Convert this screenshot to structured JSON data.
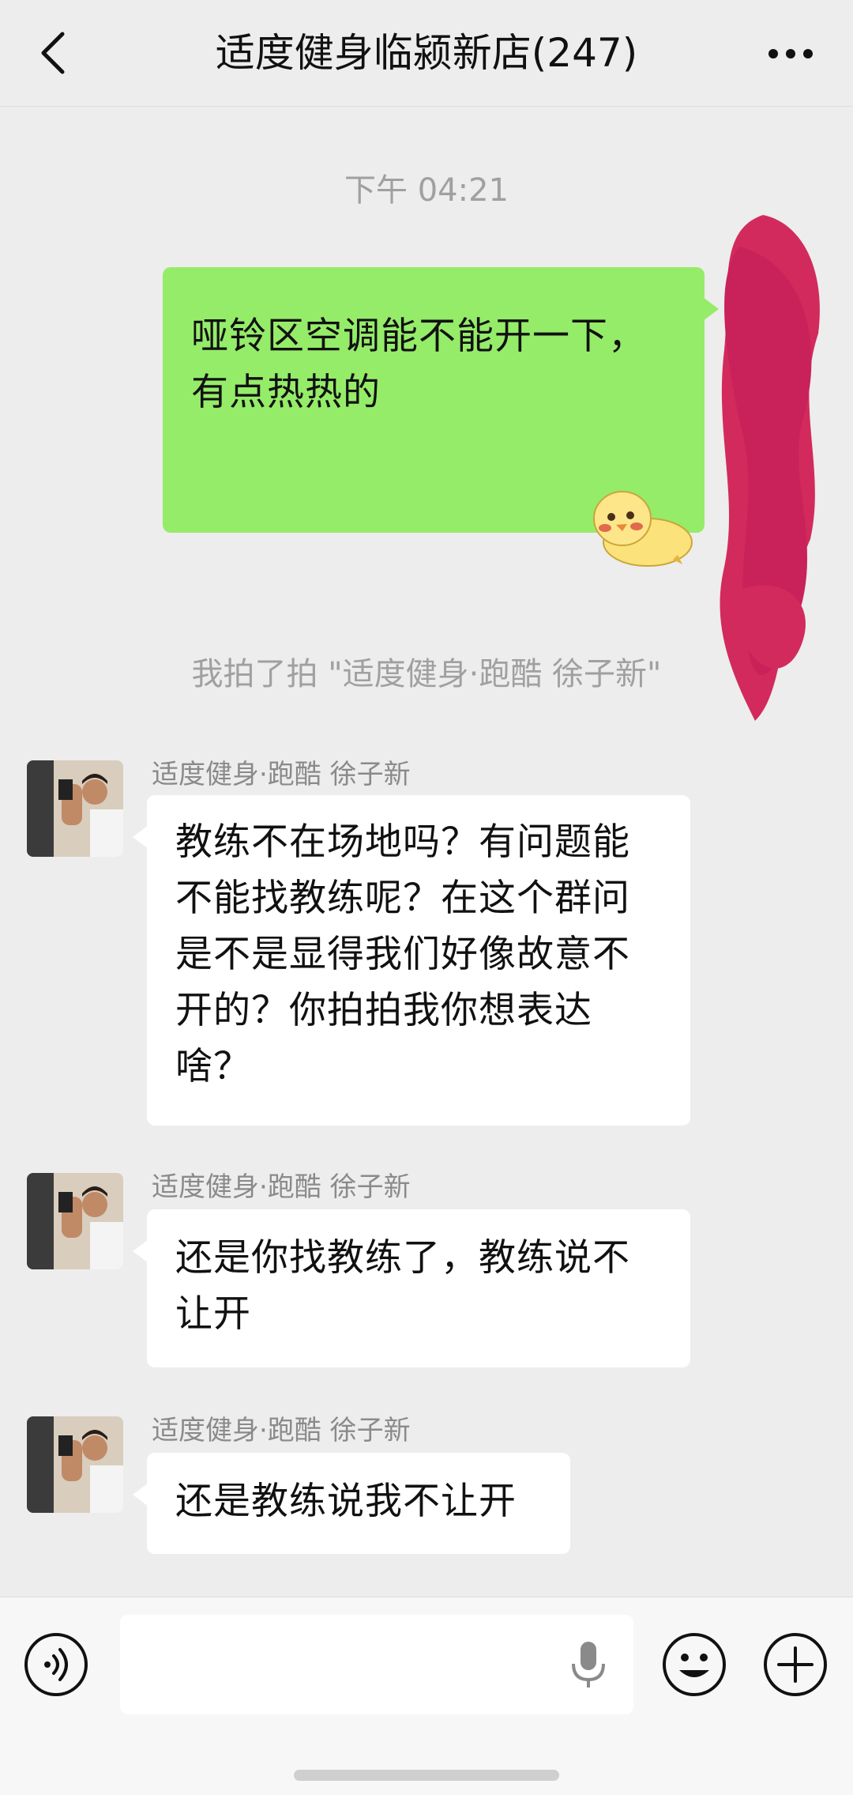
{
  "header": {
    "title": "适度健身临颍新店(247)",
    "back_icon": "chevron-left-icon",
    "more_icon": "more-dots-icon"
  },
  "chat": {
    "timestamp": "下午 04:21",
    "outgoing_message": "哑铃区空调能不能开一下，有点热热的",
    "sticker": "chick-sticker",
    "pat_notice": "我拍了拍 \"适度健身·跑酷 徐子新\"",
    "incoming": [
      {
        "sender": "适度健身·跑酷 徐子新",
        "text": "教练不在场地吗？有问题能不能找教练呢？在这个群问是不是显得我们好像故意不开的？你拍拍我你想表达啥？"
      },
      {
        "sender": "适度健身·跑酷 徐子新",
        "text": "还是你找教练了，教练说不让开"
      },
      {
        "sender": "适度健身·跑酷 徐子新",
        "text": "还是教练说我不让开"
      }
    ]
  },
  "input_bar": {
    "voice_icon": "voice-icon",
    "mic_icon": "microphone-icon",
    "emoji_icon": "emoji-icon",
    "plus_icon": "plus-icon"
  },
  "colors": {
    "background": "#ededed",
    "outgoing_bubble": "#95ec69",
    "incoming_bubble": "#ffffff",
    "redaction": "#d22a5c"
  }
}
